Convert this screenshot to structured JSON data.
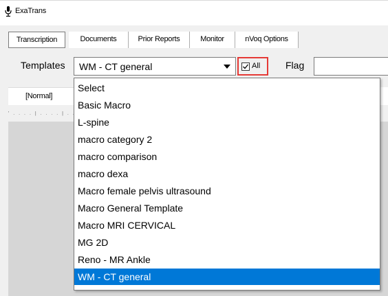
{
  "window": {
    "title": "ExaTrans"
  },
  "tabs": [
    {
      "label": "Transcription",
      "active": true
    },
    {
      "label": "Documents",
      "active": false
    },
    {
      "label": "Prior Reports",
      "active": false
    },
    {
      "label": "Monitor",
      "active": false
    },
    {
      "label": "nVoq Options",
      "active": false
    }
  ],
  "templates": {
    "label": "Templates",
    "selected": "WM - CT general",
    "all_checkbox": {
      "label": "All",
      "checked": true
    },
    "flag_label": "Flag",
    "flag_value": ""
  },
  "editor": {
    "style_label": "[Normal]",
    "ruler_text": "' . . . . | . . . . | . . ."
  },
  "dropdown": {
    "items": [
      {
        "label": "Select",
        "selected": false
      },
      {
        "label": "Basic Macro",
        "selected": false
      },
      {
        "label": "L-spine",
        "selected": false
      },
      {
        "label": "macro category 2",
        "selected": false
      },
      {
        "label": "macro comparison",
        "selected": false
      },
      {
        "label": "macro dexa",
        "selected": false
      },
      {
        "label": "Macro female pelvis ultrasound",
        "selected": false
      },
      {
        "label": "Macro General Template",
        "selected": false
      },
      {
        "label": "Macro MRI CERVICAL",
        "selected": false
      },
      {
        "label": "MG 2D",
        "selected": false
      },
      {
        "label": "Reno - MR Ankle",
        "selected": false
      },
      {
        "label": "WM - CT general",
        "selected": true
      }
    ]
  },
  "colors": {
    "selection": "#0078d7",
    "highlight_box": "#e53935",
    "background": "#f0f0f0"
  }
}
